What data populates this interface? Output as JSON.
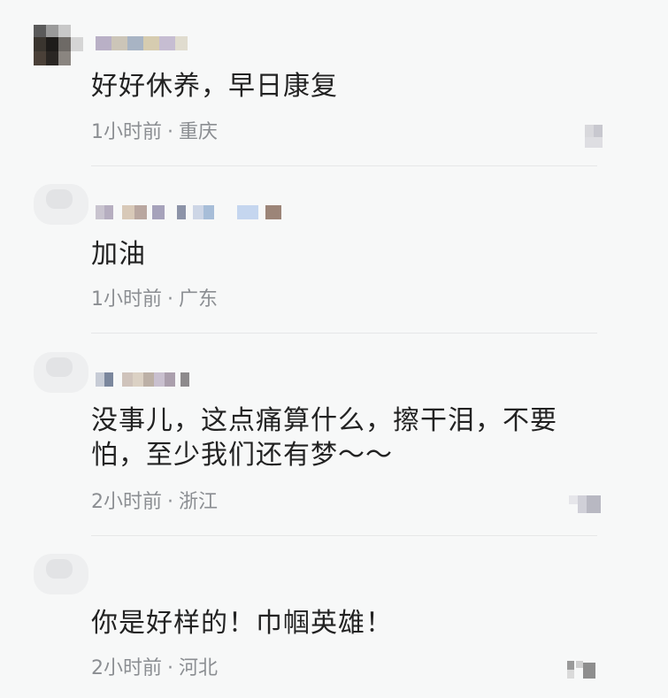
{
  "comments": [
    {
      "text": "好好休养，早日康复",
      "time": "1小时前",
      "separator": "·",
      "location": "重庆"
    },
    {
      "text": "加油",
      "time": "1小时前",
      "separator": "·",
      "location": "广东"
    },
    {
      "text": "没事儿，这点痛算什么，擦干泪，不要怕，至少我们还有梦～～",
      "time": "2小时前",
      "separator": "·",
      "location": "浙江"
    },
    {
      "text": "你是好样的！巾帼英雄！",
      "time": "2小时前",
      "separator": "·",
      "location": "河北"
    }
  ],
  "colors": {
    "background": "#f7f8f8",
    "text": "#222222",
    "meta": "#8b8e92",
    "divider": "#e6e7e8"
  },
  "icons": {
    "avatar": "blurred-avatar-image",
    "like": "pixelated-like-icon"
  }
}
